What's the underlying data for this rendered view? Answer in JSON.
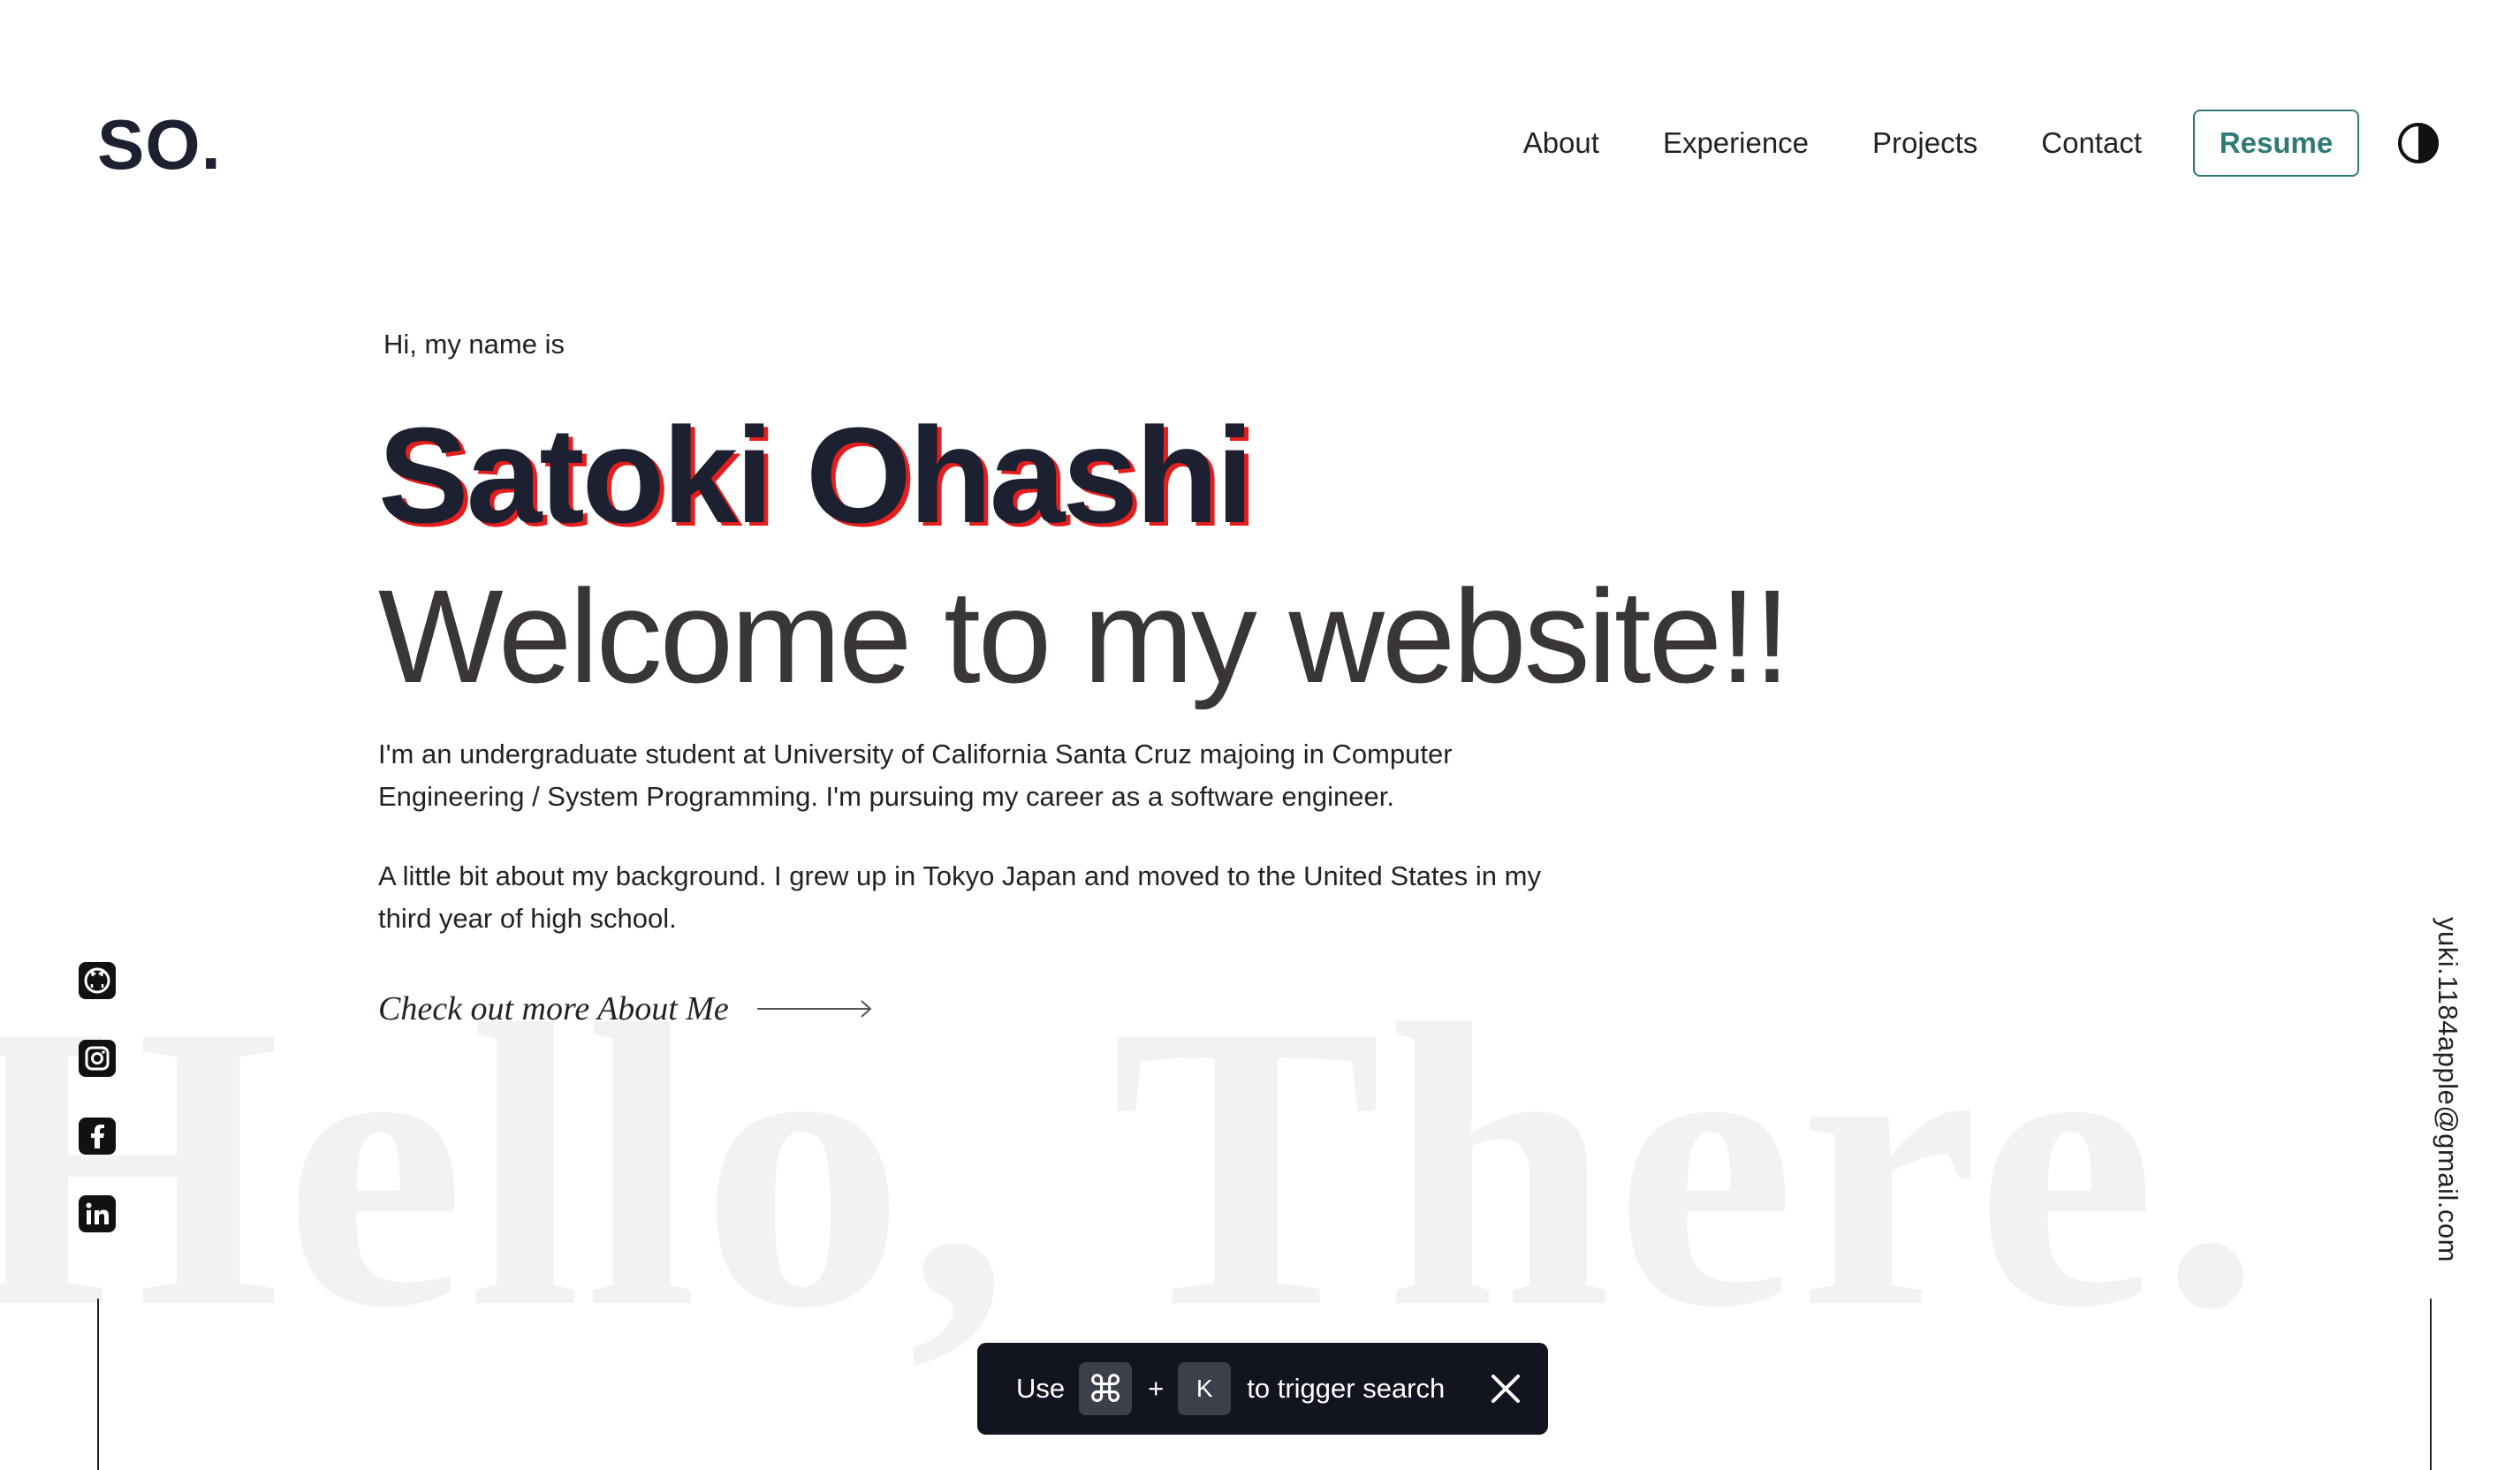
{
  "header": {
    "logo": "SO.",
    "nav": [
      "About",
      "Experience",
      "Projects",
      "Contact"
    ],
    "resume_label": "Resume",
    "accent_color": "#2f7a78"
  },
  "hero": {
    "greeting": "Hi, my name is",
    "name": "Satoki Ohashi",
    "welcome": "Welcome to my website!!",
    "bio": [
      "I'm an undergraduate student at University of California Santa Cruz majoing in Computer Engineering / System Programming. I'm pursuing my career as a software engineer.",
      "A little bit about my background. I grew up in Tokyo Japan and moved to the United States in my third year of high school."
    ],
    "cta": "Check out more About Me",
    "name_shadow_color": "#e41d1d"
  },
  "watermark": "Hello, There.",
  "social": [
    "github-icon",
    "instagram-icon",
    "facebook-icon",
    "linkedin-icon"
  ],
  "email": "yuki.1184apple@gmail.com",
  "toast": {
    "use": "Use",
    "cmd_key": "⌘",
    "plus": "+",
    "k_key": "K",
    "tail": "to trigger search"
  }
}
